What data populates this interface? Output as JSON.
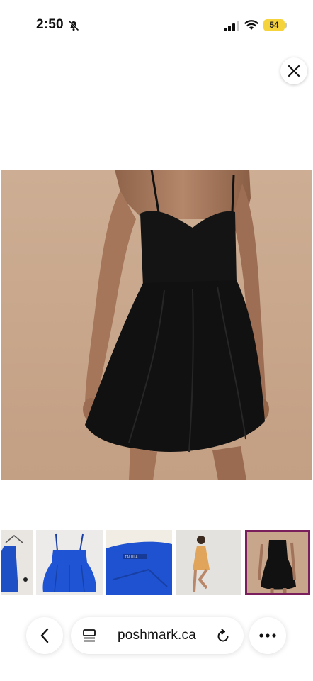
{
  "status_bar": {
    "time": "2:50",
    "battery": "54",
    "icons": [
      "bell-slash-icon",
      "cellular-signal-icon",
      "wifi-icon",
      "battery-icon"
    ]
  },
  "viewer": {
    "close_icon": "close-icon",
    "main_image_alt": "black-sleeveless-skater-dress-photo",
    "thumbnail_count": 5,
    "selected_thumbnail": 5
  },
  "browser": {
    "url": "poshmark.ca",
    "icons": [
      "back-chevron-icon",
      "reader-mode-icon",
      "reload-icon",
      "more-icon"
    ]
  },
  "colors": {
    "battery": "#f5d33c",
    "selected_outline": "#7a1f5c",
    "photo_background": "#c7a68b",
    "blue_dress": "#1f57d6"
  }
}
